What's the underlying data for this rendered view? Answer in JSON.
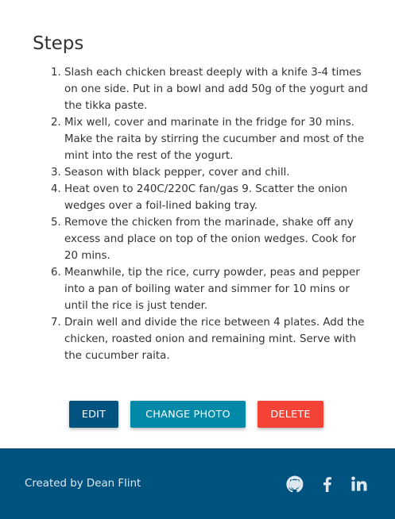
{
  "steps": {
    "title": "Steps",
    "items": [
      "Slash each chicken breast deeply with a knife 3-4 times on one side. Put in a bowl and add 50g of the yogurt and the tikka paste.",
      "Mix well, cover and marinate in the fridge for 30 mins. Make the raita by stirring the cucumber and most of the mint into the rest of the yogurt.",
      "Season with black pepper, cover and chill.",
      "Heat oven to 240C/220C fan/gas 9. Scatter the onion wedges over a foil-lined baking tray.",
      "Remove the chicken from the marinade, shake off any excess and place on top of the onion wedges. Cook for 20 mins.",
      "Meanwhile, tip the rice, curry powder, peas and pepper into a pan of boiling water and simmer for 10 mins or until the rice is just tender.",
      "Drain well and divide the rice between 4 plates. Add the chicken, roasted onion and remaining mint. Serve with the cucumber raita."
    ]
  },
  "actions": {
    "edit_label": "Edit",
    "change_photo_label": "Change Photo",
    "delete_label": "Delete"
  },
  "footer": {
    "credit": "Created by Dean Flint",
    "icons": [
      "github-icon",
      "facebook-icon",
      "linkedin-icon"
    ]
  },
  "colors": {
    "primary": "#00527f",
    "info": "#0289a8",
    "danger": "#f44336"
  }
}
